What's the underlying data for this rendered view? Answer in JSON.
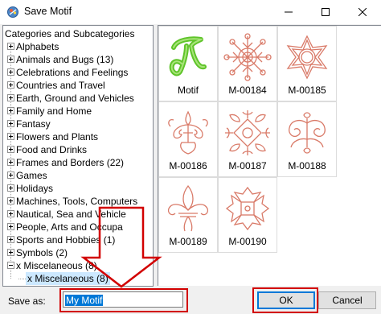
{
  "window": {
    "title": "Save Motif",
    "controls": [
      "minimize",
      "maximize",
      "close"
    ]
  },
  "tree": {
    "root": "Categories and Subcategories",
    "items": [
      {
        "label": "Alphabets",
        "expander": "plus"
      },
      {
        "label": "Animals and Bugs (13)",
        "expander": "plus"
      },
      {
        "label": "Celebrations and Feelings",
        "expander": "plus"
      },
      {
        "label": "Countries and Travel",
        "expander": "plus"
      },
      {
        "label": "Earth, Ground and Vehicles",
        "expander": "plus"
      },
      {
        "label": "Family and Home",
        "expander": "plus"
      },
      {
        "label": "Fantasy",
        "expander": "plus"
      },
      {
        "label": "Flowers and Plants",
        "expander": "plus"
      },
      {
        "label": "Food and Drinks",
        "expander": "plus"
      },
      {
        "label": "Frames and Borders (22)",
        "expander": "plus"
      },
      {
        "label": "Games",
        "expander": "plus"
      },
      {
        "label": "Holidays",
        "expander": "plus"
      },
      {
        "label": "Machines, Tools, Computers",
        "expander": "plus"
      },
      {
        "label": "Nautical, Sea and Vehicle",
        "expander": "plus"
      },
      {
        "label": "People, Arts and Occupa",
        "expander": "plus"
      },
      {
        "label": "Sports and Hobbies (1)",
        "expander": "plus"
      },
      {
        "label": "Symbols (2)",
        "expander": "plus"
      },
      {
        "label": "x Miscelaneous (8)",
        "expander": "minus"
      }
    ],
    "selected_child": "x Miscelaneous (8)"
  },
  "motifs": [
    {
      "label": "Motif",
      "icon": "green-script-letter-icon"
    },
    {
      "label": "M-00184",
      "icon": "snowflake-motif-icon"
    },
    {
      "label": "M-00185",
      "icon": "star-outline-motif-icon"
    },
    {
      "label": "M-00186",
      "icon": "damask-motif-icon"
    },
    {
      "label": "M-00187",
      "icon": "square-ornament-motif-icon"
    },
    {
      "label": "M-00188",
      "icon": "scroll-ornament-motif-icon"
    },
    {
      "label": "M-00189",
      "icon": "fleur-de-lis-motif-icon"
    },
    {
      "label": "M-00190",
      "icon": "cross-ornament-motif-icon"
    }
  ],
  "footer": {
    "save_as_label": "Save as:",
    "save_as_value": "My Motif",
    "ok_label": "OK",
    "cancel_label": "Cancel"
  },
  "colors": {
    "motif_stroke": "#d97a68",
    "motif_green": "#5fc42a",
    "annotation_red": "#d20000",
    "accent": "#0078d7"
  }
}
